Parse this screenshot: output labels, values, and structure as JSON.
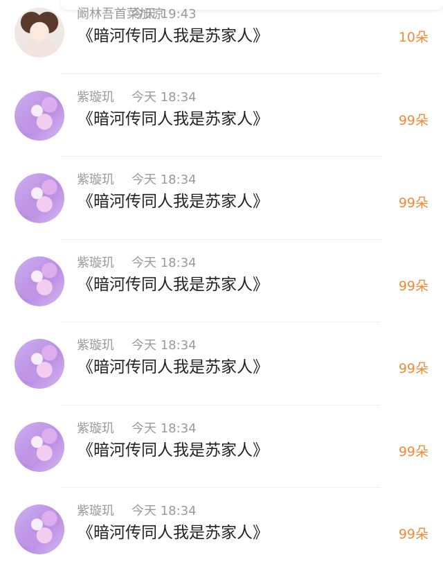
{
  "rows": [
    {
      "username": "阚林吾首菜加凉",
      "time": "今天 19:43",
      "message": "《暗河传同人我是苏家人》",
      "count": "10朵",
      "avatar": "girl-avatar"
    },
    {
      "username": "紫璇玑",
      "time": "今天 18:34",
      "message": "《暗河传同人我是苏家人》",
      "count": "99朵",
      "avatar": "purple-avatar"
    },
    {
      "username": "紫璇玑",
      "time": "今天 18:34",
      "message": "《暗河传同人我是苏家人》",
      "count": "99朵",
      "avatar": "purple-avatar"
    },
    {
      "username": "紫璇玑",
      "time": "今天 18:34",
      "message": "《暗河传同人我是苏家人》",
      "count": "99朵",
      "avatar": "purple-avatar"
    },
    {
      "username": "紫璇玑",
      "time": "今天 18:34",
      "message": "《暗河传同人我是苏家人》",
      "count": "99朵",
      "avatar": "purple-avatar"
    },
    {
      "username": "紫璇玑",
      "time": "今天 18:34",
      "message": "《暗河传同人我是苏家人》",
      "count": "99朵",
      "avatar": "purple-avatar"
    },
    {
      "username": "紫璇玑",
      "time": "今天 18:34",
      "message": "《暗河传同人我是苏家人》",
      "count": "99朵",
      "avatar": "purple-avatar"
    }
  ],
  "colors": {
    "accent": "#f08a36",
    "meta": "#9a9a9a",
    "text": "#222222",
    "divider": "#efefef"
  }
}
